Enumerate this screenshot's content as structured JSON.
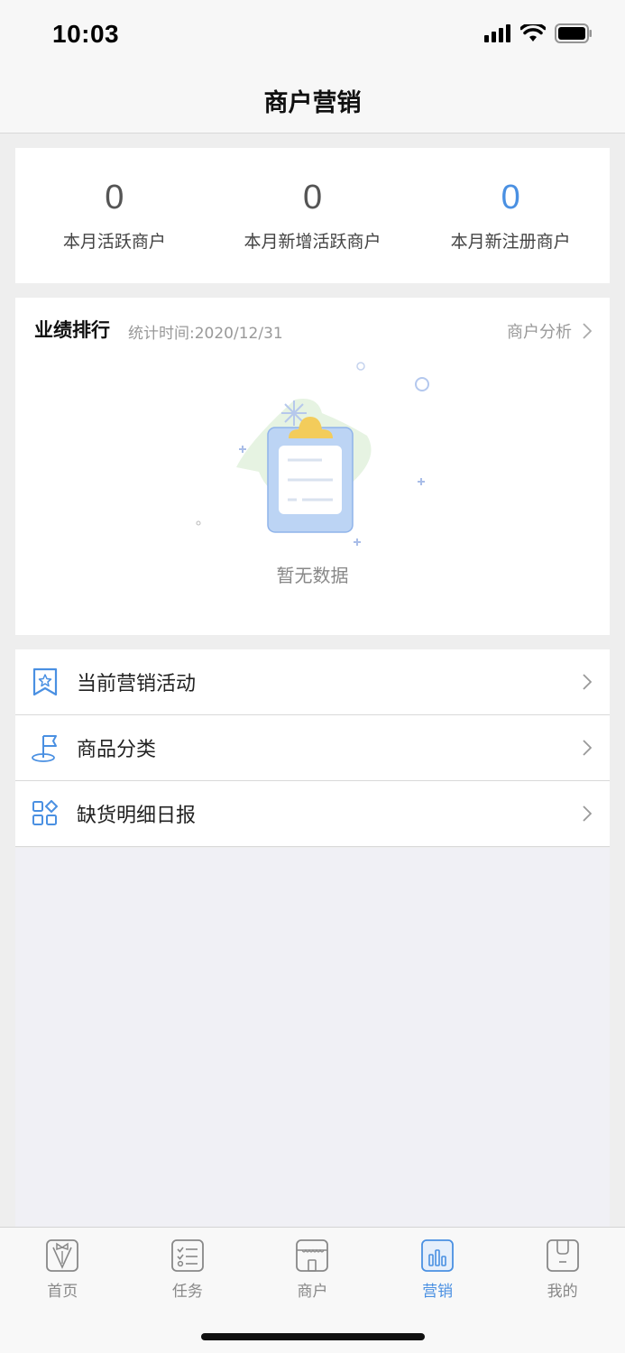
{
  "status_bar": {
    "time": "10:03"
  },
  "nav": {
    "title": "商户营销"
  },
  "stats": [
    {
      "value": "0",
      "label": "本月活跃商户"
    },
    {
      "value": "0",
      "label": "本月新增活跃商户"
    },
    {
      "value": "0",
      "label": "本月新注册商户"
    }
  ],
  "ranking": {
    "title": "业绩排行",
    "time": "统计时间:2020/12/31",
    "link_label": "商户分析",
    "empty_text": "暂无数据"
  },
  "menu": [
    {
      "label": "当前营销活动",
      "icon": "bookmark-star-icon"
    },
    {
      "label": "商品分类",
      "icon": "flag-icon"
    },
    {
      "label": "缺货明细日报",
      "icon": "grid-icon"
    }
  ],
  "tabs": [
    {
      "label": "首页",
      "icon": "home-icon",
      "active": false
    },
    {
      "label": "任务",
      "icon": "task-list-icon",
      "active": false
    },
    {
      "label": "商户",
      "icon": "store-icon",
      "active": false
    },
    {
      "label": "营销",
      "icon": "bar-chart-icon",
      "active": true
    },
    {
      "label": "我的",
      "icon": "profile-icon",
      "active": false
    }
  ],
  "colors": {
    "accent": "#4a90e2",
    "text": "#222222",
    "muted": "#999999"
  }
}
